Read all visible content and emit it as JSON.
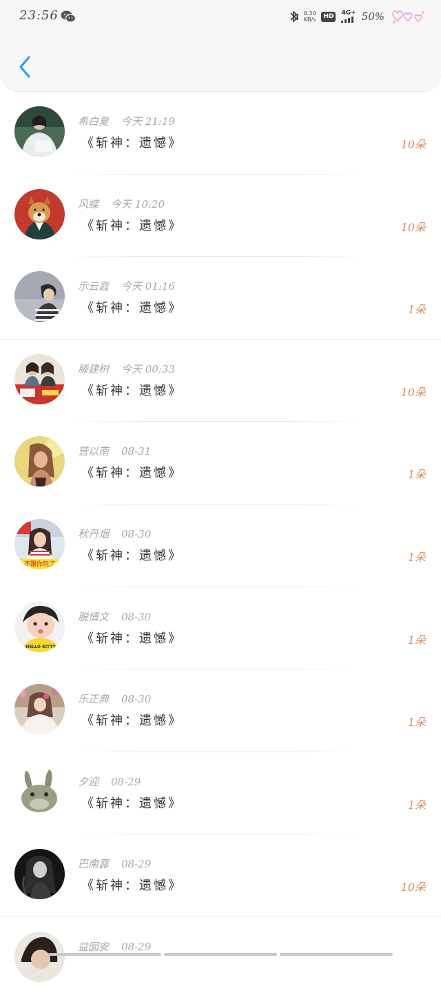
{
  "status_bar": {
    "time": "23:56",
    "net_speed_value": "0.30",
    "net_speed_unit": "KB/s",
    "hd": "HD",
    "network": "4G+",
    "battery": "50%",
    "icons": [
      "wechat-icon",
      "bluetooth-icon",
      "signal-icon",
      "hearts-decoration"
    ]
  },
  "header": {
    "back_icon": "chevron-left-icon",
    "accent_color": "#2b9af3"
  },
  "list": {
    "count_color": "#dc8a5a",
    "items": [
      {
        "name": "希白夏",
        "date": "今天 21:19",
        "gift": "《斩神：遗憾》",
        "count": "10朵"
      },
      {
        "name": "风蝶",
        "date": "今天 10:20",
        "gift": "《斩神：遗憾》",
        "count": "10朵"
      },
      {
        "name": "示云霞",
        "date": "今天 01:16",
        "gift": "《斩神：遗憾》",
        "count": "1朵"
      },
      {
        "name": "滕建树",
        "date": "今天 00:33",
        "gift": "《斩神：遗憾》",
        "count": "10朵"
      },
      {
        "name": "营以南",
        "date": "08-31",
        "gift": "《斩神：遗憾》",
        "count": "1朵"
      },
      {
        "name": "秋丹烟",
        "date": "08-30",
        "gift": "《斩神：遗憾》",
        "count": "1朵"
      },
      {
        "name": "脱情文",
        "date": "08-30",
        "gift": "《斩神：遗憾》",
        "count": "1朵"
      },
      {
        "name": "乐正典",
        "date": "08-30",
        "gift": "《斩神：遗憾》",
        "count": "1朵"
      },
      {
        "name": "夕迎",
        "date": "08-29",
        "gift": "《斩神：遗憾》",
        "count": "1朵"
      },
      {
        "name": "巴南露",
        "date": "08-29",
        "gift": "《斩神：遗憾》",
        "count": "10朵"
      },
      {
        "name": "益囡安",
        "date": "08-29",
        "gift": "",
        "count": ""
      }
    ],
    "avatar_captions": {
      "row5": "不跟你玩了",
      "row6": "HELLO KITTY"
    }
  }
}
